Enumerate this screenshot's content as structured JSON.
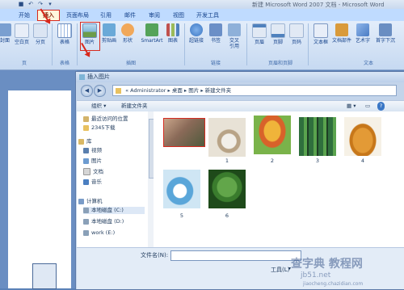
{
  "window": {
    "title": "新建 Microsoft Word 2007 文档 - Microsoft Word",
    "quick_access": [
      "save-icon",
      "undo-icon",
      "redo-icon",
      "customize-icon"
    ]
  },
  "ribbon": {
    "tabs": [
      {
        "label": "开始"
      },
      {
        "label": "插入",
        "active": true
      },
      {
        "label": "页面布局"
      },
      {
        "label": "引用"
      },
      {
        "label": "邮件"
      },
      {
        "label": "审阅"
      },
      {
        "label": "视图"
      },
      {
        "label": "开发工具"
      }
    ],
    "buttons": [
      {
        "label": "封面",
        "icon": "cover-icon",
        "color": "#7a9fd0"
      },
      {
        "label": "空白页",
        "icon": "blank-page-icon",
        "color": "#e8eef8"
      },
      {
        "label": "分页",
        "icon": "page-break-icon",
        "color": "#dbe5f3"
      },
      {
        "label": "表格",
        "icon": "table-icon",
        "color": "#9cb9e2"
      },
      {
        "label": "图片",
        "icon": "picture-icon",
        "color": "#7eb5d6"
      },
      {
        "label": "剪贴画",
        "icon": "clipart-icon",
        "color": "#6aa9d8"
      },
      {
        "label": "形状",
        "icon": "shapes-icon",
        "color": "#f1a85a"
      },
      {
        "label": "SmartArt",
        "icon": "smartart-icon",
        "color": "#55a35a"
      },
      {
        "label": "图表",
        "icon": "chart-icon",
        "color": "#c0504d"
      },
      {
        "label": "超链接",
        "icon": "hyperlink-icon",
        "color": "#3c77c4"
      },
      {
        "label": "书签",
        "icon": "bookmark-icon",
        "color": "#6b8fc7"
      },
      {
        "label": "交叉\n引用",
        "icon": "cross-reference-icon",
        "color": "#8eb0d9"
      },
      {
        "label": "页眉",
        "icon": "header-icon",
        "color": "#e1e9f4"
      },
      {
        "label": "页脚",
        "icon": "footer-icon",
        "color": "#e1e9f4"
      },
      {
        "label": "页码",
        "icon": "page-number-icon",
        "color": "#e1e9f4"
      },
      {
        "label": "文本框",
        "icon": "textbox-icon",
        "color": "#e8eef8"
      },
      {
        "label": "文档部件",
        "icon": "quick-parts-icon",
        "color": "#d99a3a"
      },
      {
        "label": "艺术字",
        "icon": "wordart-icon",
        "color": "#4a7cc4"
      },
      {
        "label": "首字下沉",
        "icon": "dropcap-icon",
        "color": "#6a8ec2"
      }
    ],
    "groups": [
      "页",
      "表格",
      "插图",
      "链接",
      "页眉和页脚",
      "文本"
    ]
  },
  "dialog": {
    "title": "插入图片",
    "breadcrumb": [
      "«",
      "Administrator",
      "桌面",
      "图片",
      "新建文件夹"
    ],
    "toolbar": {
      "organize": "组织",
      "new_folder": "新建文件夹"
    },
    "nav_items": [
      {
        "label": "最近访问的位置",
        "icon": "recent-places-icon",
        "color": "#d3b36a"
      },
      {
        "label": "2345下载",
        "icon": "folder-icon",
        "color": "#e8c160"
      },
      {
        "label": "库",
        "icon": "library-icon",
        "color": "#d9b866"
      },
      {
        "label": "视频",
        "icon": "videos-icon",
        "color": "#5a7fae"
      },
      {
        "label": "图片",
        "icon": "pictures-icon",
        "color": "#6d9bd0"
      },
      {
        "label": "文档",
        "icon": "documents-icon",
        "color": "#d6d6d6"
      },
      {
        "label": "音乐",
        "icon": "music-icon",
        "color": "#4b7fc1"
      },
      {
        "label": "计算机",
        "icon": "computer-icon",
        "color": "#7a9cc8"
      },
      {
        "label": "本地磁盘 (C:)",
        "icon": "drive-icon",
        "color": "#8aa0b8"
      },
      {
        "label": "本地磁盘 (D:)",
        "icon": "drive-icon",
        "color": "#8aa0b8"
      },
      {
        "label": "work (E:)",
        "icon": "drive-icon",
        "color": "#8aa0b8"
      }
    ],
    "images": [
      {
        "label": "",
        "selected": true,
        "colors": [
          "#8a6a58",
          "#c9a58a",
          "#4f5a3c"
        ]
      },
      {
        "label": "1",
        "colors": [
          "#e8e2d6",
          "#b8a386",
          "#f2efe9"
        ]
      },
      {
        "label": "2",
        "colors": [
          "#f0b43a",
          "#d8622a",
          "#7ab34a"
        ]
      },
      {
        "label": "3",
        "colors": [
          "#2f6f3d",
          "#5aa34e",
          "#1d3d24"
        ]
      },
      {
        "label": "4",
        "colors": [
          "#f6f1e6",
          "#e39a36",
          "#c7771a"
        ]
      },
      {
        "label": "5",
        "colors": [
          "#cfe6f4",
          "#5aa6d9",
          "#ffffff"
        ]
      },
      {
        "label": "6",
        "colors": [
          "#3a7c2d",
          "#62a64a",
          "#1e4a1a"
        ]
      }
    ],
    "filename_label": "文件名(N):",
    "filename_value": "",
    "tools_label": "工具(L)"
  },
  "watermark": {
    "line1": "查字典 教程网",
    "line2": "jb51.net",
    "line3": "jiaocheng.chazidian.com"
  }
}
